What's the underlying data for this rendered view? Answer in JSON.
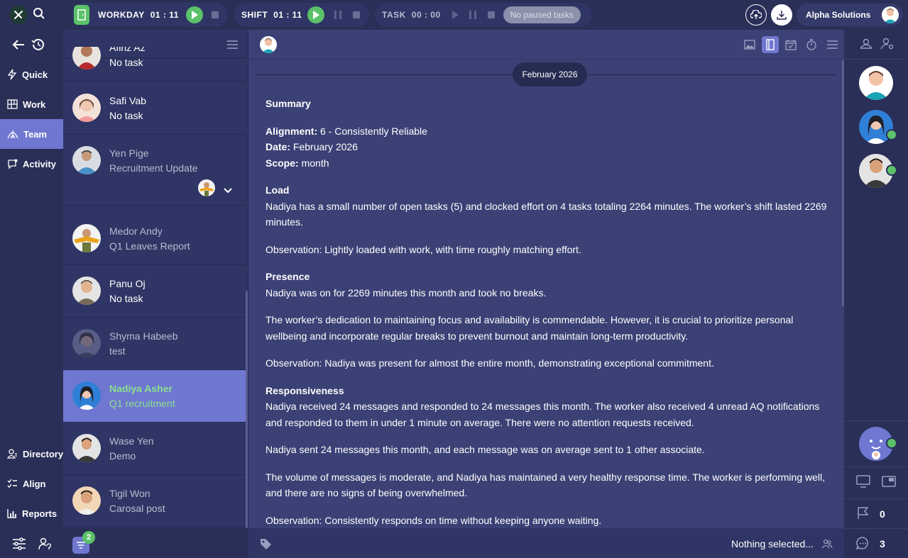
{
  "topbar": {
    "workday": {
      "label": "WORKDAY",
      "time": "01 : 11"
    },
    "shift": {
      "label": "SHIFT",
      "time": "01 : 11"
    },
    "task": {
      "label": "TASK",
      "time": "00 : 00"
    },
    "paused": "No paused tasks",
    "company": "Alpha Solutions"
  },
  "nav": {
    "items": [
      {
        "label": "Quick",
        "icon": "lightning-icon"
      },
      {
        "label": "Work",
        "icon": "grid-icon"
      },
      {
        "label": "Team",
        "icon": "team-icon",
        "active": true
      },
      {
        "label": "Activity",
        "icon": "activity-icon"
      }
    ],
    "bottom": [
      {
        "label": "Directory",
        "icon": "directory-icon"
      },
      {
        "label": "Align",
        "icon": "align-icon"
      },
      {
        "label": "Reports",
        "icon": "reports-icon"
      }
    ]
  },
  "people": [
    {
      "name": "Afiriz Az",
      "task": "No task"
    },
    {
      "name": "Safi Vab",
      "task": "No task"
    },
    {
      "name": "Yen Pige",
      "task": "Recruitment Update"
    },
    {
      "name": "Medor Andy",
      "task": "Q1 Leaves Report"
    },
    {
      "name": "Panu Oj",
      "task": "No task"
    },
    {
      "name": "Shyma Habeeb",
      "task": "test"
    },
    {
      "name": "Nadiya Asher",
      "task": "Q1 recruitment"
    },
    {
      "name": "Wase Yen",
      "task": "Demo"
    },
    {
      "name": "Tigil Won",
      "task": "Carosal post"
    }
  ],
  "filter_badge": "2",
  "main": {
    "month": "February 2026",
    "summary_title": "Summary",
    "alignment_label": "Alignment:",
    "alignment_value": "6 - Consistently Reliable",
    "date_label": "Date:",
    "date_value": "February 2026",
    "scope_label": "Scope:",
    "scope_value": "month",
    "load_title": "Load",
    "load_text": "Nadiya has a small number of open tasks (5) and clocked effort on 4 tasks totaling 2264 minutes. The worker’s shift lasted 2269 minutes.",
    "load_obs": "Observation: Lightly loaded with work, with time roughly matching effort.",
    "presence_title": "Presence",
    "presence_text": "Nadiya was on for 2269 minutes this month and took no breaks.",
    "presence_text2": "The worker’s dedication to maintaining focus and availability is commendable. However, it is crucial to prioritize personal wellbeing and incorporate regular breaks to prevent burnout and maintain long-term productivity.",
    "presence_obs": "Observation: Nadiya was present for almost the entire month, demonstrating exceptional commitment.",
    "resp_title": "Responsiveness",
    "resp_text": "Nadiya received 24 messages and responded to 24 messages this month. The worker also received 4 unread AQ notifications and responded to them in under 1 minute on average. There were no attention requests received.",
    "resp_text2": "Nadiya sent 24 messages this month, and each message was on average sent to 1 other associate.",
    "resp_text3": "The volume of messages is moderate, and Nadiya has maintained a very healthy response time. The worker is performing well, and there are no signs of being overwhelmed.",
    "resp_obs": "Observation: Consistently responds on time without keeping anyone waiting.",
    "footer_selection": "Nothing selected..."
  },
  "rail": {
    "flag_count": "0",
    "chat_count": "3"
  },
  "colors": {
    "accent": "#6f77d0",
    "green": "#5bc26a",
    "bg": "#3b4175"
  }
}
